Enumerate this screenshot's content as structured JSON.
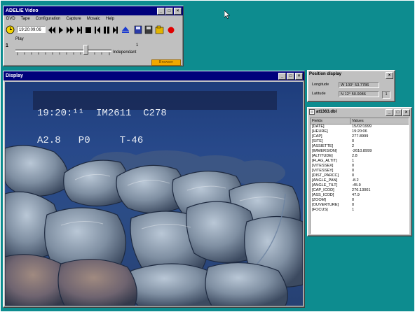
{
  "video_window": {
    "title": "ADELIE Video",
    "menus": [
      "DVD",
      "Tape",
      "Configuration",
      "Capture",
      "Mosaic",
      "Help"
    ],
    "timecode": "19:20:09:06",
    "mode_label": "Play",
    "slider_left_value": "1",
    "slider_right_value": "1",
    "mode_option": "Independant",
    "bottom_button": "Browser"
  },
  "display_window": {
    "title": "Display",
    "overlay_line1": "19:20:¹¹  IM2611  C278",
    "overlay_line2": "A2.8   P0     T-46"
  },
  "position_window": {
    "title": "Position display",
    "longitude_label": "Longitude",
    "longitude_value": "W 103° 53.7786",
    "latitude_label": "Latitude",
    "latitude_value": "N 12° 50.0086",
    "side_value": "1"
  },
  "data_window": {
    "title": "at1363.dbl",
    "col_field": "Fields",
    "col_values": "Values",
    "rows": [
      {
        "field": "[DATE]",
        "value": "15/02/1999"
      },
      {
        "field": "[HEURE]",
        "value": "19:20:06"
      },
      {
        "field": "[CAP]",
        "value": "277.8999"
      },
      {
        "field": "[SITE]",
        "value": "0"
      },
      {
        "field": "[ASSIETTE]",
        "value": "2"
      },
      {
        "field": "[IMMERSION]",
        "value": "-2610.8999"
      },
      {
        "field": "[ALTITUDE]",
        "value": "2.8"
      },
      {
        "field": "[FLAG_ALTIT]",
        "value": "1"
      },
      {
        "field": "[VITESSEX]",
        "value": "0"
      },
      {
        "field": "[VITESSEY]",
        "value": "0"
      },
      {
        "field": "[DIST_PARCC]",
        "value": "0"
      },
      {
        "field": "[ANGLE_PAN]",
        "value": "-8.2"
      },
      {
        "field": "[ANGLE_TILT]",
        "value": "-45.9"
      },
      {
        "field": "[CAP_ICOD]",
        "value": "276.13001"
      },
      {
        "field": "[ASS_ICOD]",
        "value": "47.9"
      },
      {
        "field": "[ZOOM]",
        "value": "0"
      },
      {
        "field": "[OUVERTURE]",
        "value": "0"
      },
      {
        "field": "[FOCUS]",
        "value": "1"
      }
    ]
  },
  "colors": {
    "desktop": "#0d8c8f",
    "title_bar": "#00007b",
    "window_face": "#c0c0c0",
    "browser_button": "#f0a800"
  }
}
